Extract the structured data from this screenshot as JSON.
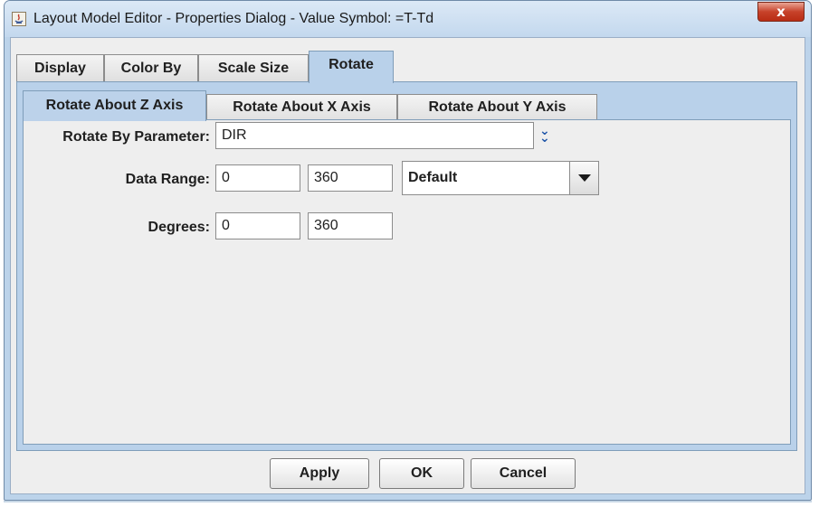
{
  "window": {
    "title": "Layout Model Editor - Properties Dialog - Value Symbol: =T-Td",
    "app_icon": "java-icon",
    "close_label": "x"
  },
  "tabs": [
    {
      "label": "Display",
      "active": false
    },
    {
      "label": "Color By",
      "active": false
    },
    {
      "label": "Scale Size",
      "active": false
    },
    {
      "label": "Rotate",
      "active": true
    }
  ],
  "subtabs": [
    {
      "label": "Rotate About Z Axis",
      "active": true
    },
    {
      "label": "Rotate About X Axis",
      "active": false
    },
    {
      "label": "Rotate About Y Axis",
      "active": false
    }
  ],
  "form": {
    "rotate_by_label": "Rotate By Parameter:",
    "rotate_by_value": "DIR",
    "rotate_by_chooser_icon": "double-chevron-down-icon",
    "data_range_label": "Data Range:",
    "data_range_min": "0",
    "data_range_max": "360",
    "data_range_preset": "Default",
    "degrees_label": "Degrees:",
    "degrees_min": "0",
    "degrees_max": "360"
  },
  "buttons": {
    "apply": "Apply",
    "ok": "OK",
    "cancel": "Cancel"
  },
  "colors": {
    "active_tab": "#b9d1ea",
    "chooser_icon": "#2157a9",
    "close_button": "#c7422a"
  }
}
